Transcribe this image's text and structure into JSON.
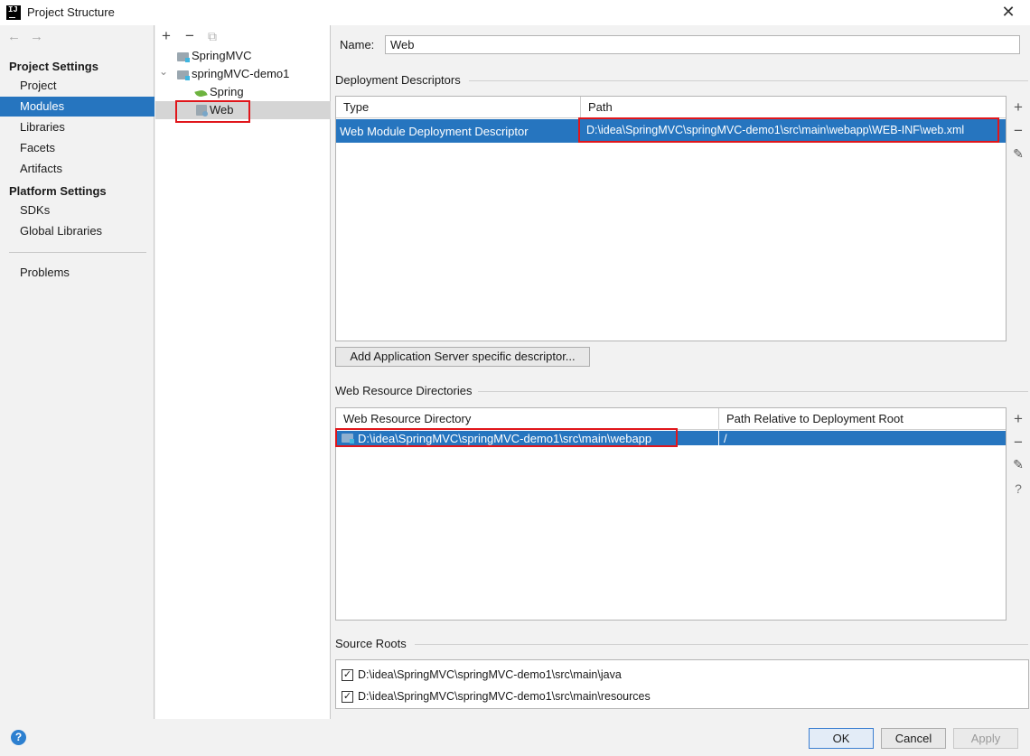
{
  "window": {
    "title": "Project Structure",
    "close_glyph": "✕"
  },
  "nav": {
    "back_glyph": "←",
    "forward_glyph": "→",
    "project_settings_heading": "Project Settings",
    "project_settings_items": [
      "Project",
      "Modules",
      "Libraries",
      "Facets",
      "Artifacts"
    ],
    "platform_settings_heading": "Platform Settings",
    "platform_settings_items": [
      "SDKs",
      "Global Libraries"
    ],
    "problems_label": "Problems",
    "selected": "Modules"
  },
  "tree": {
    "add_glyph": "+",
    "remove_glyph": "−",
    "copy_glyph": "⧉",
    "expand_glyph": "⌄",
    "nodes": [
      {
        "label": "SpringMVC",
        "icon": "module-folder-icon"
      },
      {
        "label": "springMVC-demo1",
        "icon": "module-folder-icon",
        "expanded": true
      },
      {
        "label": "Spring",
        "icon": "spring-leaf-icon"
      },
      {
        "label": "Web",
        "icon": "web-facet-icon",
        "selected": true
      }
    ]
  },
  "facet": {
    "name_label": "Name:",
    "name_value": "Web",
    "deployment_descriptors": {
      "title": "Deployment Descriptors",
      "columns": [
        "Type",
        "Path"
      ],
      "rows": [
        {
          "type": "Web Module Deployment Descriptor",
          "path": "D:\\idea\\SpringMVC\\springMVC-demo1\\src\\main\\webapp\\WEB-INF\\web.xml"
        }
      ],
      "add_server_descriptor_button": "Add Application Server specific descriptor..."
    },
    "web_resource_directories": {
      "title": "Web Resource Directories",
      "columns": [
        "Web Resource Directory",
        "Path Relative to Deployment Root"
      ],
      "rows": [
        {
          "directory": "D:\\idea\\SpringMVC\\springMVC-demo1\\src\\main\\webapp",
          "relative_path": "/"
        }
      ]
    },
    "source_roots": {
      "title": "Source Roots",
      "items": [
        {
          "path": "D:\\idea\\SpringMVC\\springMVC-demo1\\src\\main\\java",
          "checked": true
        },
        {
          "path": "D:\\idea\\SpringMVC\\springMVC-demo1\\src\\main\\resources",
          "checked": true
        }
      ]
    },
    "side_buttons": {
      "add": "+",
      "remove": "−",
      "edit": "✎",
      "help": "?"
    }
  },
  "footer": {
    "help_glyph": "?",
    "ok_label": "OK",
    "cancel_label": "Cancel",
    "apply_label": "Apply"
  },
  "colors": {
    "selection": "#2675bf",
    "highlight_box": "#e0161b",
    "ok_border": "#3c7fd1"
  }
}
